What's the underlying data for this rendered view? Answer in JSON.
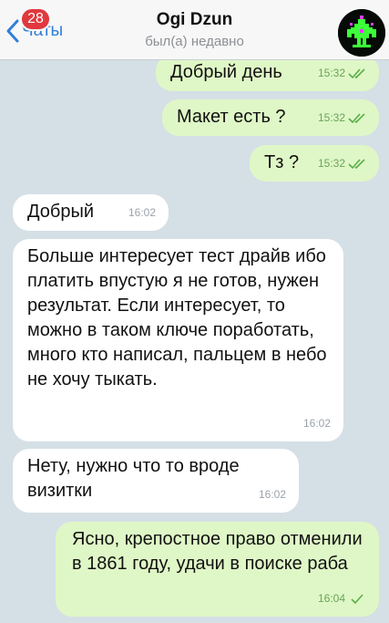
{
  "header": {
    "back_label": "Чаты",
    "unread_count": "28",
    "contact_name": "Ogi Dzun",
    "status": "был(а) недавно"
  },
  "colors": {
    "accent": "#2f7fd8",
    "outgoing_bubble": "#dff7c6",
    "incoming_bubble": "#ffffff",
    "badge": "#e0383e",
    "chat_background": "#d5dfe6"
  },
  "messages": [
    {
      "direction": "out",
      "text": "Добрый день",
      "time": "15:32",
      "status_icon": "double-check-icon"
    },
    {
      "direction": "out",
      "text": "Макет есть ?",
      "time": "15:32",
      "status_icon": "double-check-icon"
    },
    {
      "direction": "out",
      "text": "Тз ?",
      "time": "15:32",
      "status_icon": "double-check-icon"
    },
    {
      "direction": "in",
      "text": "Добрый",
      "time": "16:02"
    },
    {
      "direction": "in",
      "text": "Больше интересует тест драйв ибо платить впустую я не готов,  нужен результат. Если интересует,  то можно в таком ключе поработать, много кто написал,  пальцем в небо не хочу тыкать.",
      "time": "16:02"
    },
    {
      "direction": "in",
      "text": "Нету,  нужно что то вроде визитки",
      "time": "16:02"
    },
    {
      "direction": "out",
      "text": "Ясно, крепостное право отменили в 1861 году, удачи в поиске раба",
      "time": "16:04",
      "status_icon": "single-check-icon"
    }
  ]
}
